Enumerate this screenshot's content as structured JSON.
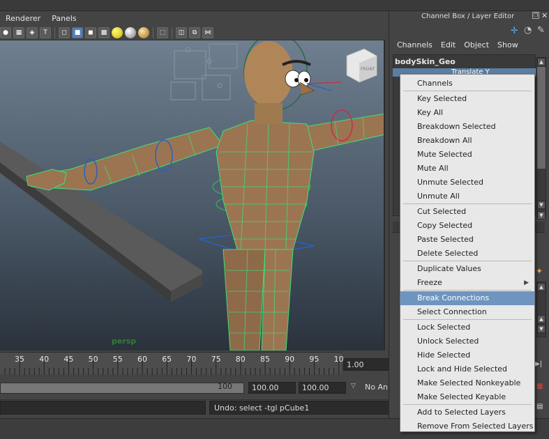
{
  "viewport": {
    "menu": [
      "Renderer",
      "Panels"
    ],
    "camera_label": "persp",
    "viewcube_label": "FRONT"
  },
  "timeline": {
    "ticks": [
      "35",
      "40",
      "45",
      "50",
      "55",
      "60",
      "65",
      "70",
      "75",
      "80",
      "85",
      "90",
      "95",
      "10"
    ],
    "current_frame": "1.00"
  },
  "range": {
    "end_marker": "100",
    "start_value": "100.00",
    "end_value": "100.00",
    "anim_layer": "No Anim La"
  },
  "command": {
    "result": "Undo: select -tgl pCube1"
  },
  "channel_box": {
    "title": "Channel Box / Layer Editor",
    "menu": [
      "Channels",
      "Edit",
      "Object",
      "Show"
    ],
    "object_name": "bodySkin_Geo",
    "selected_channel": "Translate Y"
  },
  "context_menu": {
    "groups": [
      [
        {
          "label": "Channels"
        }
      ],
      [
        {
          "label": "Key Selected"
        },
        {
          "label": "Key All"
        },
        {
          "label": "Breakdown Selected"
        },
        {
          "label": "Breakdown All"
        },
        {
          "label": "Mute Selected"
        },
        {
          "label": "Mute All"
        },
        {
          "label": "Unmute Selected"
        },
        {
          "label": "Unmute All"
        }
      ],
      [
        {
          "label": "Cut Selected"
        },
        {
          "label": "Copy Selected"
        },
        {
          "label": "Paste Selected"
        },
        {
          "label": "Delete Selected"
        }
      ],
      [
        {
          "label": "Duplicate Values"
        },
        {
          "label": "Freeze"
        }
      ],
      [
        {
          "label": "Break Connections"
        },
        {
          "label": "Select Connection"
        }
      ],
      [
        {
          "label": "Lock Selected"
        },
        {
          "label": "Unlock Selected"
        },
        {
          "label": "Hide Selected"
        },
        {
          "label": "Lock and Hide Selected"
        },
        {
          "label": "Make Selected Nonkeyable"
        },
        {
          "label": "Make Selected Keyable"
        }
      ],
      [
        {
          "label": "Add to Selected Layers"
        },
        {
          "label": "Remove From Selected Layers"
        }
      ]
    ],
    "highlighted": "Break Connections",
    "submenu_item": "Freeze"
  },
  "colors": {
    "wireframe": "#39e37a",
    "skin": "#9b7552",
    "highlight": "#6d95c0"
  }
}
